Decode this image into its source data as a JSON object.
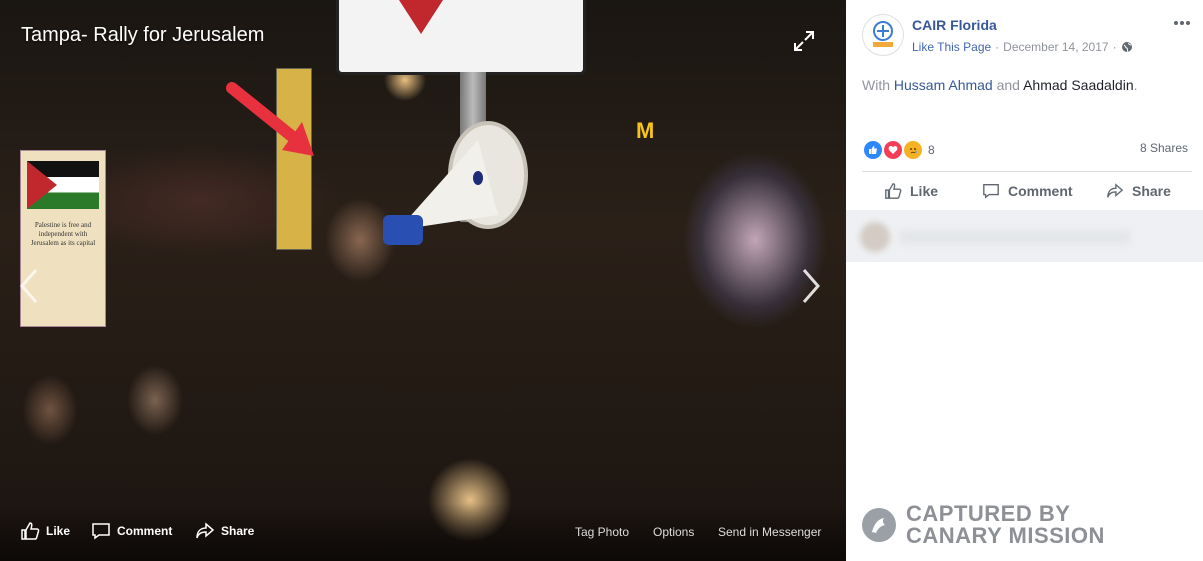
{
  "photo": {
    "title": "Tampa- Rally for Jerusalem",
    "actions": {
      "like": "Like",
      "comment": "Comment",
      "share": "Share"
    },
    "right_actions": {
      "tag_photo": "Tag Photo",
      "options": "Options",
      "send_messenger": "Send in Messenger"
    },
    "scene_text": {
      "mcdonalds": "M",
      "flag_text": "Palestine is free and independent with Jerusalem as its capital"
    }
  },
  "post": {
    "page_name": "CAIR Florida",
    "like_page": "Like This Page",
    "date": "December 14, 2017",
    "separator": "·",
    "caption_prefix": "With ",
    "person1": "Hussam Ahmad",
    "caption_and": " and ",
    "person2": "Ahmad Saadaldin",
    "caption_suffix": ".",
    "reaction_count": "8",
    "shares": "8 Shares",
    "actions": {
      "like": "Like",
      "comment": "Comment",
      "share": "Share"
    },
    "avatar_text": "CAIR"
  },
  "watermark": {
    "line1": "CAPTURED BY",
    "line2": "CANARY MISSION"
  },
  "colors": {
    "link_blue": "#365899",
    "meta_gray": "#90949c",
    "like_blue": "#2d88ff",
    "love_red": "#f33e58",
    "sad_yellow": "#f7b125",
    "arrow_red": "#e8313e"
  }
}
